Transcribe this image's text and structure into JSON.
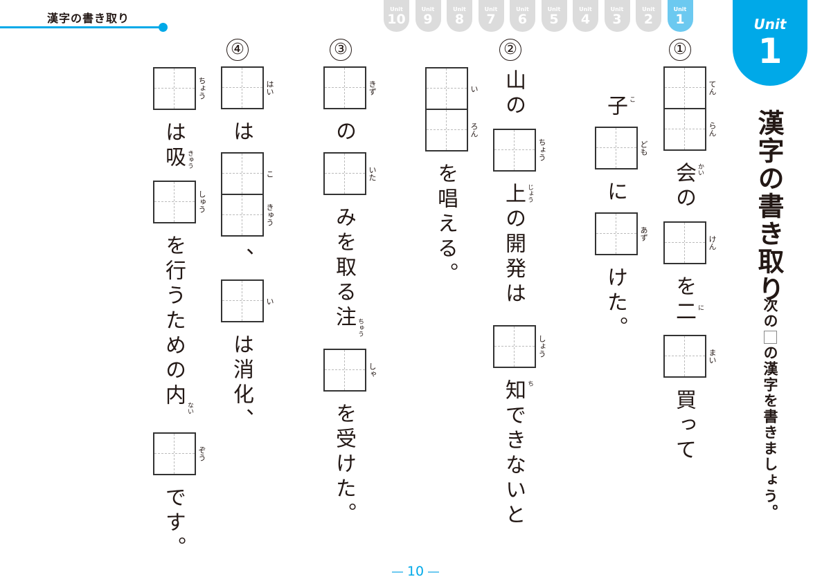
{
  "header": {
    "section_title": "漢字の書き取り"
  },
  "unit_tabs": [
    {
      "label": "Unit",
      "number": "10",
      "active": false
    },
    {
      "label": "Unit",
      "number": "9",
      "active": false
    },
    {
      "label": "Unit",
      "number": "8",
      "active": false
    },
    {
      "label": "Unit",
      "number": "7",
      "active": false
    },
    {
      "label": "Unit",
      "number": "6",
      "active": false
    },
    {
      "label": "Unit",
      "number": "5",
      "active": false
    },
    {
      "label": "Unit",
      "number": "4",
      "active": false
    },
    {
      "label": "Unit",
      "number": "3",
      "active": false
    },
    {
      "label": "Unit",
      "number": "2",
      "active": false
    },
    {
      "label": "Unit",
      "number": "1",
      "active": true
    }
  ],
  "unit_badge": {
    "label": "Unit",
    "number": "1"
  },
  "page_title": "漢字の書き取り",
  "instruction": {
    "before": "次の",
    "after": "の漢字を書きましょう。"
  },
  "colors": {
    "accent": "#00a9e8",
    "accent_light": "#6cc9f0",
    "tab_inactive": "#dcdcdc"
  },
  "questions": [
    {
      "number": "①",
      "columns": [
        [
          {
            "type": "box",
            "readings": [
              "てん",
              "らん"
            ]
          },
          {
            "type": "text",
            "text": "会の",
            "ruby": {
              "char": "会",
              "reading": "かい"
            }
          },
          {
            "type": "box",
            "readings": [
              "けん"
            ]
          },
          {
            "type": "text",
            "text": "を二",
            "ruby": {
              "char": "二",
              "reading": "に"
            }
          },
          {
            "type": "box",
            "readings": [
              "まい"
            ]
          },
          {
            "type": "text",
            "text": "買って"
          }
        ],
        [
          {
            "type": "text",
            "text": "子",
            "ruby": {
              "char": "子",
              "reading": "こ"
            }
          },
          {
            "type": "box",
            "readings": [
              "ども"
            ]
          },
          {
            "type": "text",
            "text": "に"
          },
          {
            "type": "box",
            "readings": [
              "あず"
            ]
          },
          {
            "type": "text",
            "text": "けた。"
          }
        ]
      ]
    },
    {
      "number": "②",
      "columns": [
        [
          {
            "type": "text",
            "text": "山の"
          },
          {
            "type": "box",
            "readings": [
              "ちょう"
            ]
          },
          {
            "type": "text",
            "text": "上の開発は",
            "ruby": {
              "char": "上",
              "reading": "じょう"
            }
          },
          {
            "type": "box",
            "readings": [
              "しょう"
            ]
          },
          {
            "type": "text",
            "text": "知できないと",
            "ruby": {
              "char": "知",
              "reading": "ち"
            }
          }
        ],
        [
          {
            "type": "box",
            "readings": [
              "い",
              "ろん"
            ]
          },
          {
            "type": "text",
            "text": "を唱える。"
          }
        ]
      ]
    },
    {
      "number": "③",
      "columns": [
        [
          {
            "type": "box",
            "readings": [
              "きず"
            ]
          },
          {
            "type": "text",
            "text": "の"
          },
          {
            "type": "box",
            "readings": [
              "いた"
            ]
          },
          {
            "type": "text",
            "text": "みを取る注",
            "ruby": {
              "char": "注",
              "reading": "ちゅう"
            }
          },
          {
            "type": "box",
            "readings": [
              "しゃ"
            ]
          },
          {
            "type": "text",
            "text": "を受けた。"
          }
        ]
      ]
    },
    {
      "number": "④",
      "columns": [
        [
          {
            "type": "box",
            "readings": [
              "はい"
            ]
          },
          {
            "type": "text",
            "text": "は"
          },
          {
            "type": "box",
            "readings": [
              "こ",
              "きゅう"
            ]
          },
          {
            "type": "text",
            "text": "、"
          },
          {
            "type": "box",
            "readings": [
              "い"
            ]
          },
          {
            "type": "text",
            "text": "は消化、"
          }
        ],
        [
          {
            "type": "box",
            "readings": [
              "ちょう"
            ]
          },
          {
            "type": "text",
            "text": "は吸",
            "ruby": {
              "char": "吸",
              "reading": "きゅう"
            }
          },
          {
            "type": "box",
            "readings": [
              "しゅう"
            ]
          },
          {
            "type": "text",
            "text": "を行うための内",
            "ruby": {
              "char": "内",
              "reading": "ない"
            }
          },
          {
            "type": "box",
            "readings": [
              "ぞう"
            ]
          },
          {
            "type": "text",
            "text": "です。"
          }
        ]
      ]
    }
  ],
  "page_number": "10"
}
